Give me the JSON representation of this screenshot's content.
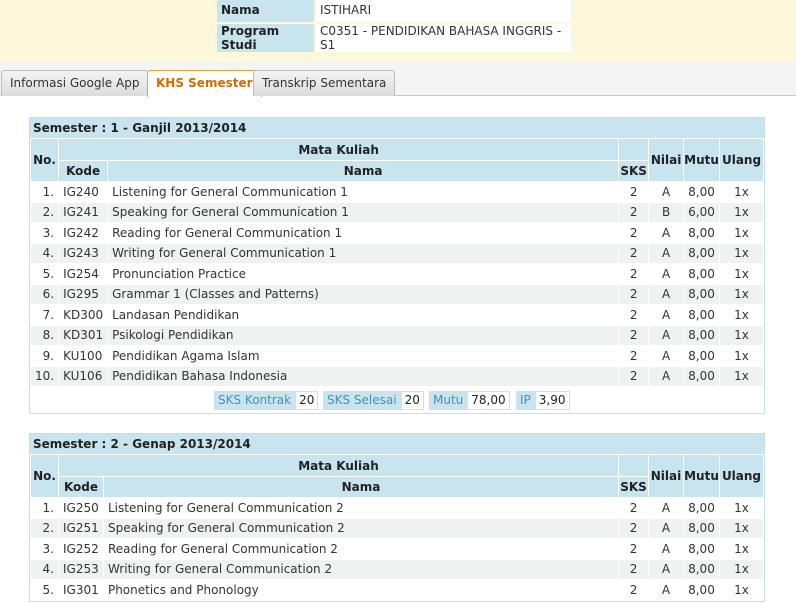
{
  "student": {
    "name_label": "Nama",
    "name_value": "ISTIHARI",
    "program_label": "Program Studi",
    "program_value": "C0351 - PENDIDIKAN BAHASA INGGRIS - S1"
  },
  "tabs": [
    {
      "label": "Informasi Google App"
    },
    {
      "label": "KHS Semester",
      "active": true
    },
    {
      "label": "Transkrip Sementara"
    }
  ],
  "headers": {
    "no": "No.",
    "mata_kuliah": "Mata Kuliah",
    "kode": "Kode",
    "nama": "Nama",
    "sks": "SKS",
    "nilai": "Nilai",
    "mutu": "Mutu",
    "ulang": "Ulang"
  },
  "semesters": [
    {
      "title": "Semester : 1 - Ganjil 2013/2014",
      "rows": [
        {
          "no": "1.",
          "kode": "IG240",
          "nama": "Listening for General Communication 1",
          "sks": "2",
          "nilai": "A",
          "mutu": "8,00",
          "ulang": "1x"
        },
        {
          "no": "2.",
          "kode": "IG241",
          "nama": "Speaking for General Communication 1",
          "sks": "2",
          "nilai": "B",
          "mutu": "6,00",
          "ulang": "1x"
        },
        {
          "no": "3.",
          "kode": "IG242",
          "nama": "Reading for General Communication 1",
          "sks": "2",
          "nilai": "A",
          "mutu": "8,00",
          "ulang": "1x"
        },
        {
          "no": "4.",
          "kode": "IG243",
          "nama": "Writing for General Communication 1",
          "sks": "2",
          "nilai": "A",
          "mutu": "8,00",
          "ulang": "1x"
        },
        {
          "no": "5.",
          "kode": "IG254",
          "nama": "Pronunciation Practice",
          "sks": "2",
          "nilai": "A",
          "mutu": "8,00",
          "ulang": "1x"
        },
        {
          "no": "6.",
          "kode": "IG295",
          "nama": "Grammar 1 (Classes and Patterns)",
          "sks": "2",
          "nilai": "A",
          "mutu": "8,00",
          "ulang": "1x"
        },
        {
          "no": "7.",
          "kode": "KD300",
          "nama": "Landasan Pendidikan",
          "sks": "2",
          "nilai": "A",
          "mutu": "8,00",
          "ulang": "1x"
        },
        {
          "no": "8.",
          "kode": "KD301",
          "nama": "Psikologi Pendidikan",
          "sks": "2",
          "nilai": "A",
          "mutu": "8,00",
          "ulang": "1x"
        },
        {
          "no": "9.",
          "kode": "KU100",
          "nama": "Pendidikan Agama Islam",
          "sks": "2",
          "nilai": "A",
          "mutu": "8,00",
          "ulang": "1x"
        },
        {
          "no": "10.",
          "kode": "KU106",
          "nama": "Pendidikan Bahasa Indonesia",
          "sks": "2",
          "nilai": "A",
          "mutu": "8,00",
          "ulang": "1x"
        }
      ],
      "summary": {
        "sks_kontrak_label": "SKS Kontrak",
        "sks_kontrak": "20",
        "sks_selesai_label": "SKS Selesai",
        "sks_selesai": "20",
        "mutu_label": "Mutu",
        "mutu": "78,00",
        "ip_label": "IP",
        "ip": "3,90"
      }
    },
    {
      "title": "Semester : 2 - Genap 2013/2014",
      "rows": [
        {
          "no": "1.",
          "kode": "IG250",
          "nama": "Listening for General Communication 2",
          "sks": "2",
          "nilai": "A",
          "mutu": "8,00",
          "ulang": "1x"
        },
        {
          "no": "2.",
          "kode": "IG251",
          "nama": "Speaking for General Communication 2",
          "sks": "2",
          "nilai": "A",
          "mutu": "8,00",
          "ulang": "1x"
        },
        {
          "no": "3.",
          "kode": "IG252",
          "nama": "Reading for General Communication 2",
          "sks": "2",
          "nilai": "A",
          "mutu": "8,00",
          "ulang": "1x"
        },
        {
          "no": "4.",
          "kode": "IG253",
          "nama": "Writing for General Communication 2",
          "sks": "2",
          "nilai": "A",
          "mutu": "8,00",
          "ulang": "1x"
        },
        {
          "no": "5.",
          "kode": "IG301",
          "nama": "Phonetics and Phonology",
          "sks": "2",
          "nilai": "A",
          "mutu": "8,00",
          "ulang": "1x"
        }
      ]
    }
  ]
}
